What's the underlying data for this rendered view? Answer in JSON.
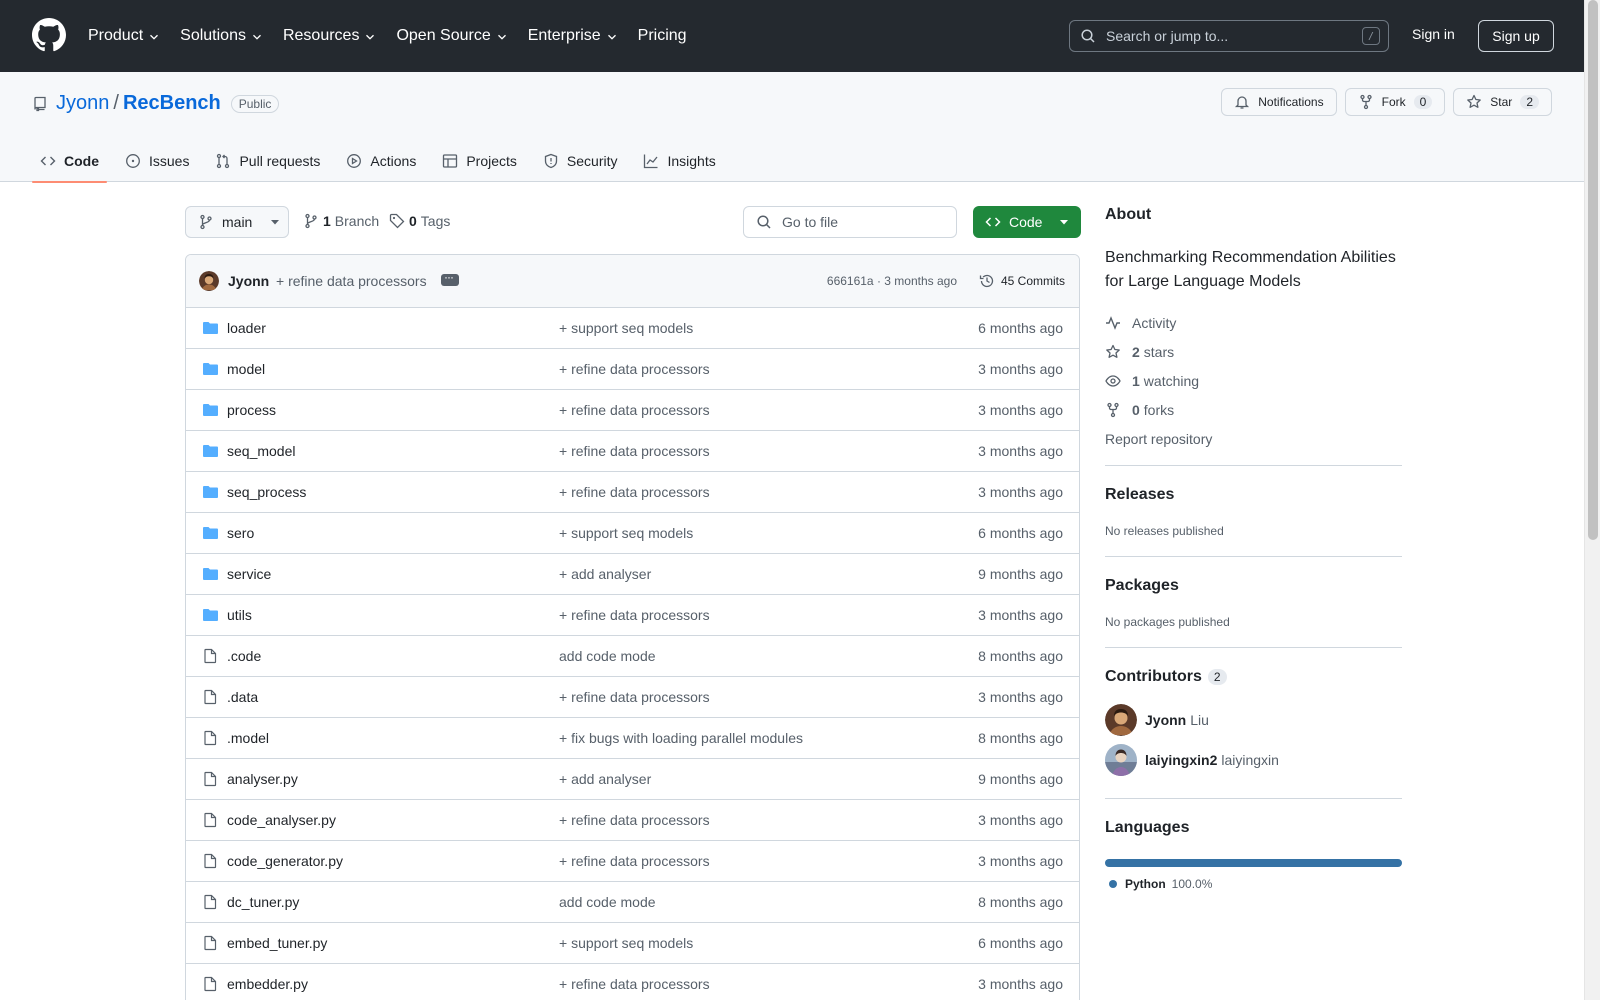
{
  "header": {
    "nav": [
      "Product",
      "Solutions",
      "Resources",
      "Open Source",
      "Enterprise",
      "Pricing"
    ],
    "search_placeholder": "Search or jump to...",
    "search_shortcut": "/",
    "signin": "Sign in",
    "signup": "Sign up"
  },
  "repo": {
    "owner": "Jyonn",
    "slash": "/",
    "name": "RecBench",
    "visibility": "Public",
    "notifications": "Notifications",
    "fork_label": "Fork",
    "fork_count": "0",
    "star_label": "Star",
    "star_count": "2"
  },
  "tabs": [
    "Code",
    "Issues",
    "Pull requests",
    "Actions",
    "Projects",
    "Security",
    "Insights"
  ],
  "toolbar": {
    "branch": "main",
    "branch_count": "1",
    "branch_label": "Branch",
    "tag_count": "0",
    "tag_label": "Tags",
    "gofile_placeholder": "Go to file",
    "code_button": "Code"
  },
  "latest_commit": {
    "author": "Jyonn",
    "message": "+ refine data processors",
    "sha_time": "666161a · 3 months ago",
    "commits": "45 Commits"
  },
  "files": [
    {
      "type": "dir",
      "name": "loader",
      "message": "+ support seq models",
      "date": "6 months ago"
    },
    {
      "type": "dir",
      "name": "model",
      "message": "+ refine data processors",
      "date": "3 months ago"
    },
    {
      "type": "dir",
      "name": "process",
      "message": "+ refine data processors",
      "date": "3 months ago"
    },
    {
      "type": "dir",
      "name": "seq_model",
      "message": "+ refine data processors",
      "date": "3 months ago"
    },
    {
      "type": "dir",
      "name": "seq_process",
      "message": "+ refine data processors",
      "date": "3 months ago"
    },
    {
      "type": "dir",
      "name": "sero",
      "message": "+ support seq models",
      "date": "6 months ago"
    },
    {
      "type": "dir",
      "name": "service",
      "message": "+ add analyser",
      "date": "9 months ago"
    },
    {
      "type": "dir",
      "name": "utils",
      "message": "+ refine data processors",
      "date": "3 months ago"
    },
    {
      "type": "file",
      "name": ".code",
      "message": "add code mode",
      "date": "8 months ago"
    },
    {
      "type": "file",
      "name": ".data",
      "message": "+ refine data processors",
      "date": "3 months ago"
    },
    {
      "type": "file",
      "name": ".model",
      "message": "+ fix bugs with loading parallel modules",
      "date": "8 months ago"
    },
    {
      "type": "file",
      "name": "analyser.py",
      "message": "+ add analyser",
      "date": "9 months ago"
    },
    {
      "type": "file",
      "name": "code_analyser.py",
      "message": "+ refine data processors",
      "date": "3 months ago"
    },
    {
      "type": "file",
      "name": "code_generator.py",
      "message": "+ refine data processors",
      "date": "3 months ago"
    },
    {
      "type": "file",
      "name": "dc_tuner.py",
      "message": "add code mode",
      "date": "8 months ago"
    },
    {
      "type": "file",
      "name": "embed_tuner.py",
      "message": "+ support seq models",
      "date": "6 months ago"
    },
    {
      "type": "file",
      "name": "embedder.py",
      "message": "+ refine data processors",
      "date": "3 months ago"
    }
  ],
  "about": {
    "title": "About",
    "description": "Benchmarking Recommendation Abilities for Large Language Models",
    "activity": "Activity",
    "stars_count": "2",
    "stars_label": "stars",
    "watching_count": "1",
    "watching_label": "watching",
    "forks_count": "0",
    "forks_label": "forks",
    "report": "Report repository"
  },
  "releases": {
    "title": "Releases",
    "note": "No releases published"
  },
  "packages": {
    "title": "Packages",
    "note": "No packages published"
  },
  "contributors": {
    "title": "Contributors",
    "count": "2",
    "list": [
      {
        "login": "Jyonn",
        "name": "Liu"
      },
      {
        "login": "laiyingxin2",
        "name": "laiyingxin"
      }
    ]
  },
  "languages": {
    "title": "Languages",
    "items": [
      {
        "name": "Python",
        "percent": "100.0%",
        "color": "#3572A5"
      }
    ]
  },
  "colors": {
    "header_bg": "#24292f",
    "link": "#0969da",
    "green_button": "#1f883d",
    "folder": "#54aeff",
    "tab_underline": "#fd8c73"
  }
}
